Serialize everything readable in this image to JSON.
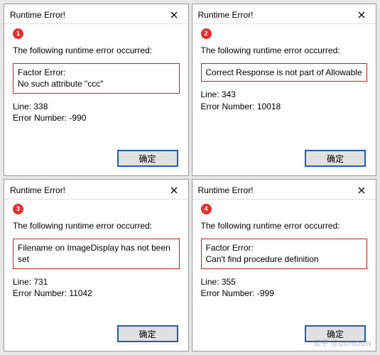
{
  "dialogs": [
    {
      "badge": "1",
      "title": "Runtime Error!",
      "intro": "The following runtime error occurred:",
      "error_lines": [
        "Factor Error:",
        "No such attribute \"ccc\""
      ],
      "line_label": "Line: 338",
      "errnum_label": "Error Number: -990",
      "ok_label": "确定"
    },
    {
      "badge": "2",
      "title": "Runtime Error!",
      "intro": "The following runtime error occurred:",
      "error_lines": [
        "Correct Response is not part of Allowable"
      ],
      "line_label": "Line: 343",
      "errnum_label": "Error Number: 10018",
      "ok_label": "确定"
    },
    {
      "badge": "3",
      "title": "Runtime Error!",
      "intro": "The following runtime error occurred:",
      "error_lines": [
        "Filename on ImageDisplay has not been set"
      ],
      "line_label": "Line: 731",
      "errnum_label": "Error Number: 11042",
      "ok_label": "确定"
    },
    {
      "badge": "4",
      "title": "Runtime Error!",
      "intro": "The following runtime error occurred:",
      "error_lines": [
        "Factor Error:",
        "Can't find procedure definition"
      ],
      "line_label": "Line: 355",
      "errnum_label": "Error Number: -999",
      "ok_label": "确定"
    }
  ],
  "watermark": "知乎 @DUNDUN"
}
